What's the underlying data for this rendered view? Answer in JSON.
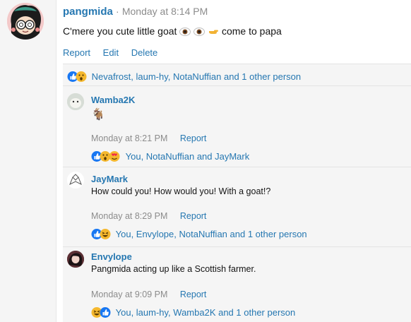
{
  "post": {
    "author": "pangmida",
    "separator": "·",
    "time": "Monday at 8:14 PM",
    "text_before": "C'mere you cute little goat ",
    "text_after": " come to papa",
    "emojis": [
      "eye-emoji",
      "eye-emoji",
      "pointing-hand-emoji"
    ],
    "actions": {
      "report": "Report",
      "edit": "Edit",
      "delete": "Delete"
    },
    "reactions": {
      "icons": [
        "like",
        "wow"
      ],
      "text": "Nevafrost, laum-hy, NotaNuffian and 1 other person"
    }
  },
  "replies": [
    {
      "author": "Wamba2K",
      "body": "🐐",
      "time": "Monday at 8:21 PM",
      "report": "Report",
      "reactions": {
        "icons": [
          "like",
          "wow",
          "love"
        ],
        "text": "You, NotaNuffian and JayMark"
      }
    },
    {
      "author": "JayMark",
      "body": "How could you! How would you! With a goat!?",
      "time": "Monday at 8:29 PM",
      "report": "Report",
      "reactions": {
        "icons": [
          "like",
          "haha"
        ],
        "text": "You, Envylope, NotaNuffian and 1 other person"
      }
    },
    {
      "author": "Envylope",
      "body": "Pangmida acting up like a Scottish farmer.",
      "time": "Monday at 9:09 PM",
      "report": "Report",
      "reactions": {
        "icons": [
          "haha",
          "like"
        ],
        "text": "You, laum-hy, Wamba2K and 1 other person"
      }
    }
  ],
  "colors": {
    "link": "#2577b1",
    "muted": "#8c8c8c",
    "panel": "#f5f5f5",
    "like": "#1877f2",
    "wow": "#f5b82e",
    "love": "#f02849"
  }
}
